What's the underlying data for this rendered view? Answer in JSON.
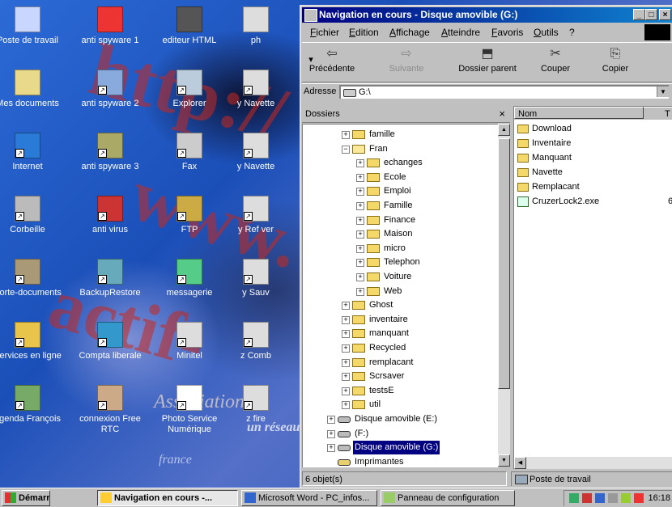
{
  "desktop": {
    "watermarks": [
      "http://",
      "www.",
      "actif-",
      "Association",
      "un réseau",
      "france"
    ],
    "icons": [
      {
        "label": "Poste de travail",
        "icon": "my-computer-icon"
      },
      {
        "label": "anti spyware 1",
        "icon": "se-spyware-icon"
      },
      {
        "label": "editeur HTML",
        "icon": "bug-icon"
      },
      {
        "label": "ph",
        "icon": "app-icon"
      },
      {
        "label": "Mes documents",
        "icon": "my-documents-icon"
      },
      {
        "label": "anti spyware 2",
        "icon": "spyware-scan-icon"
      },
      {
        "label": "Explorer",
        "icon": "explorer-icon"
      },
      {
        "label": "y Navette",
        "icon": "app-icon"
      },
      {
        "label": "Internet",
        "icon": "internet-explorer-icon"
      },
      {
        "label": "anti spyware 3",
        "icon": "shield-user-icon"
      },
      {
        "label": "Fax",
        "icon": "fax-icon"
      },
      {
        "label": "y Navette",
        "icon": "app-icon"
      },
      {
        "label": "Corbeille",
        "icon": "recycle-bin-icon"
      },
      {
        "label": "anti virus",
        "icon": "antivirus-icon"
      },
      {
        "label": "FTP",
        "icon": "ftp-icon"
      },
      {
        "label": "y Ref ver",
        "icon": "app-icon"
      },
      {
        "label": "Porte-documents",
        "icon": "briefcase-icon"
      },
      {
        "label": "BackupRestore",
        "icon": "backup-icon"
      },
      {
        "label": "messagerie",
        "icon": "messenger-icon"
      },
      {
        "label": "y Sauv",
        "icon": "app-icon"
      },
      {
        "label": "Services en ligne",
        "icon": "folder-icon"
      },
      {
        "label": "Compta liberale",
        "icon": "accounting-icon"
      },
      {
        "label": "Minitel",
        "icon": "minitel-icon"
      },
      {
        "label": "z Comb",
        "icon": "app-icon"
      },
      {
        "label": "agenda François",
        "icon": "agenda-icon"
      },
      {
        "label": "connexion Free RTC",
        "icon": "connection-icon"
      },
      {
        "label": "Photo Service Numérique",
        "icon": "photo-service-icon"
      },
      {
        "label": "z fire",
        "icon": "app-icon"
      }
    ]
  },
  "window": {
    "title": "Navigation en cours - Disque amovible (G:)",
    "menu": [
      "Fichier",
      "Edition",
      "Affichage",
      "Atteindre",
      "Favoris",
      "Outils",
      "?"
    ],
    "toolbar": [
      {
        "label": "Précédente",
        "icon": "back-arrow-icon",
        "enabled": true
      },
      {
        "label": "Suivante",
        "icon": "forward-arrow-icon",
        "enabled": false
      },
      {
        "label": "Dossier parent",
        "icon": "parent-folder-icon",
        "enabled": true
      },
      {
        "label": "Couper",
        "icon": "scissors-icon",
        "enabled": true
      },
      {
        "label": "Copier",
        "icon": "copy-icon",
        "enabled": true
      }
    ],
    "address_label": "Adresse",
    "address_value": "G:\\",
    "folders_header": "Dossiers",
    "tree": [
      {
        "label": "famille",
        "sign": "+",
        "kind": "folder",
        "level": 1
      },
      {
        "label": "Fran",
        "sign": "−",
        "kind": "folder-open",
        "level": 1
      },
      {
        "label": "echanges",
        "sign": "+",
        "kind": "folder",
        "level": 2
      },
      {
        "label": "Ecole",
        "sign": "+",
        "kind": "folder",
        "level": 2
      },
      {
        "label": "Emploi",
        "sign": "+",
        "kind": "folder",
        "level": 2
      },
      {
        "label": "Famille",
        "sign": "+",
        "kind": "folder",
        "level": 2
      },
      {
        "label": "Finance",
        "sign": "+",
        "kind": "folder",
        "level": 2
      },
      {
        "label": "Maison",
        "sign": "+",
        "kind": "folder",
        "level": 2
      },
      {
        "label": "micro",
        "sign": "+",
        "kind": "folder",
        "level": 2
      },
      {
        "label": "Telephon",
        "sign": "+",
        "kind": "folder",
        "level": 2
      },
      {
        "label": "Voiture",
        "sign": "+",
        "kind": "folder",
        "level": 2
      },
      {
        "label": "Web",
        "sign": "+",
        "kind": "folder",
        "level": 2
      },
      {
        "label": "Ghost",
        "sign": "+",
        "kind": "folder",
        "level": 1
      },
      {
        "label": "inventaire",
        "sign": "+",
        "kind": "folder",
        "level": 1
      },
      {
        "label": "manquant",
        "sign": "+",
        "kind": "folder",
        "level": 1
      },
      {
        "label": "Recycled",
        "sign": "+",
        "kind": "folder",
        "level": 1
      },
      {
        "label": "remplacant",
        "sign": "+",
        "kind": "folder",
        "level": 1
      },
      {
        "label": "Scrsaver",
        "sign": "+",
        "kind": "folder",
        "level": 1
      },
      {
        "label": "testsE",
        "sign": "+",
        "kind": "folder",
        "level": 1
      },
      {
        "label": "util",
        "sign": "+",
        "kind": "folder",
        "level": 1
      },
      {
        "label": "Disque amovible (E:)",
        "sign": "+",
        "kind": "drive",
        "level": 0
      },
      {
        "label": "(F:)",
        "sign": "+",
        "kind": "drive",
        "level": 0
      },
      {
        "label": "Disque amovible (G:)",
        "sign": "+",
        "kind": "drive",
        "level": 0,
        "selected": true
      },
      {
        "label": "Imprimantes",
        "sign": "",
        "kind": "printer",
        "level": 0
      }
    ],
    "list_headers": [
      "Nom",
      "T"
    ],
    "files": [
      {
        "name": "Download",
        "kind": "folder",
        "size": ""
      },
      {
        "name": "Inventaire",
        "kind": "folder",
        "size": ""
      },
      {
        "name": "Manquant",
        "kind": "folder",
        "size": ""
      },
      {
        "name": "Navette",
        "kind": "folder",
        "size": ""
      },
      {
        "name": "Remplacant",
        "kind": "folder",
        "size": ""
      },
      {
        "name": "CruzerLock2.exe",
        "kind": "exe",
        "size": "6"
      }
    ],
    "status_left": "6 objet(s)",
    "status_right": "Poste de travail"
  },
  "taskbar": {
    "start": "Démarrer",
    "tasks": [
      {
        "label": "Navigation en cours -...",
        "active": true,
        "icon": "explorer-icon"
      },
      {
        "label": "Microsoft Word - PC_infos...",
        "active": false,
        "icon": "word-icon"
      },
      {
        "label": "Panneau de configuration",
        "active": false,
        "icon": "control-panel-icon"
      }
    ],
    "clock": "16:18"
  },
  "colors": {
    "titlebar": "#000080",
    "selection": "#000080",
    "desktop": "#1b4fb8",
    "watermark": "#c8281e"
  }
}
